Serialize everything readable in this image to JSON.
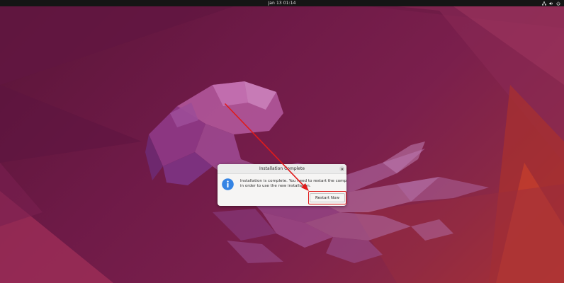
{
  "topbar": {
    "clock": "Jan 13  01:14",
    "tray_icons": [
      "network-icon",
      "volume-icon",
      "power-icon"
    ]
  },
  "dialog": {
    "title": "Installation Complete",
    "message_line1": "Installation is complete. You need to restart the computer",
    "message_line2": "in order to use the new installation.",
    "button_label": "Restart Now",
    "icon": "info-icon"
  },
  "colors": {
    "topbar": "#151515",
    "wallpaper_base": "#6e1a47",
    "wallpaper_warm": "#b3362f",
    "info_icon": "#3584e4",
    "annotation": "#e01b1b"
  }
}
